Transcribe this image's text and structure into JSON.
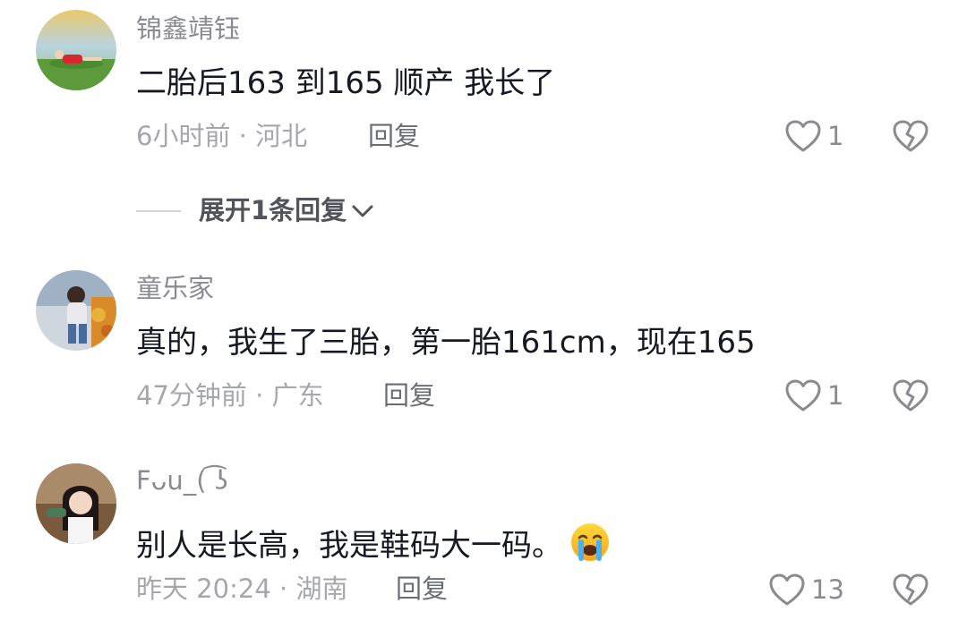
{
  "comments": [
    {
      "username": "锦鑫靖钰",
      "text": "二胎后163 到165 顺产  我长了",
      "meta": "6小时前 · 河北",
      "reply_label": "回复",
      "likes": "1",
      "avatar_icon": "avatar-outdoor-photo",
      "like_icon": "heart-outline-icon",
      "dislike_icon": "broken-heart-icon"
    },
    {
      "username": "童乐家",
      "text": "真的，我生了三胎，第一胎161cm，现在165",
      "meta": "47分钟前 · 广东",
      "reply_label": "回复",
      "likes": "1",
      "avatar_icon": "avatar-child-photo",
      "like_icon": "heart-outline-icon",
      "dislike_icon": "broken-heart-icon"
    },
    {
      "username": "Fᴗu_( ͡ʖ",
      "text": "别人是长高，我是鞋码大一码。",
      "meta": "昨天 20:24 · 湖南",
      "reply_label": "回复",
      "likes": "13",
      "avatar_icon": "avatar-woman-photo",
      "emoji_icon": "crying-face-emoji",
      "like_icon": "heart-outline-icon",
      "dislike_icon": "broken-heart-icon"
    }
  ],
  "expand_replies": {
    "label": "展开1条回复",
    "icon": "chevron-down-icon"
  },
  "colors": {
    "text_primary": "#161823",
    "text_secondary": "#8a8b91",
    "text_meta": "#a6a7ad",
    "icon_gray": "#8a8b91"
  }
}
